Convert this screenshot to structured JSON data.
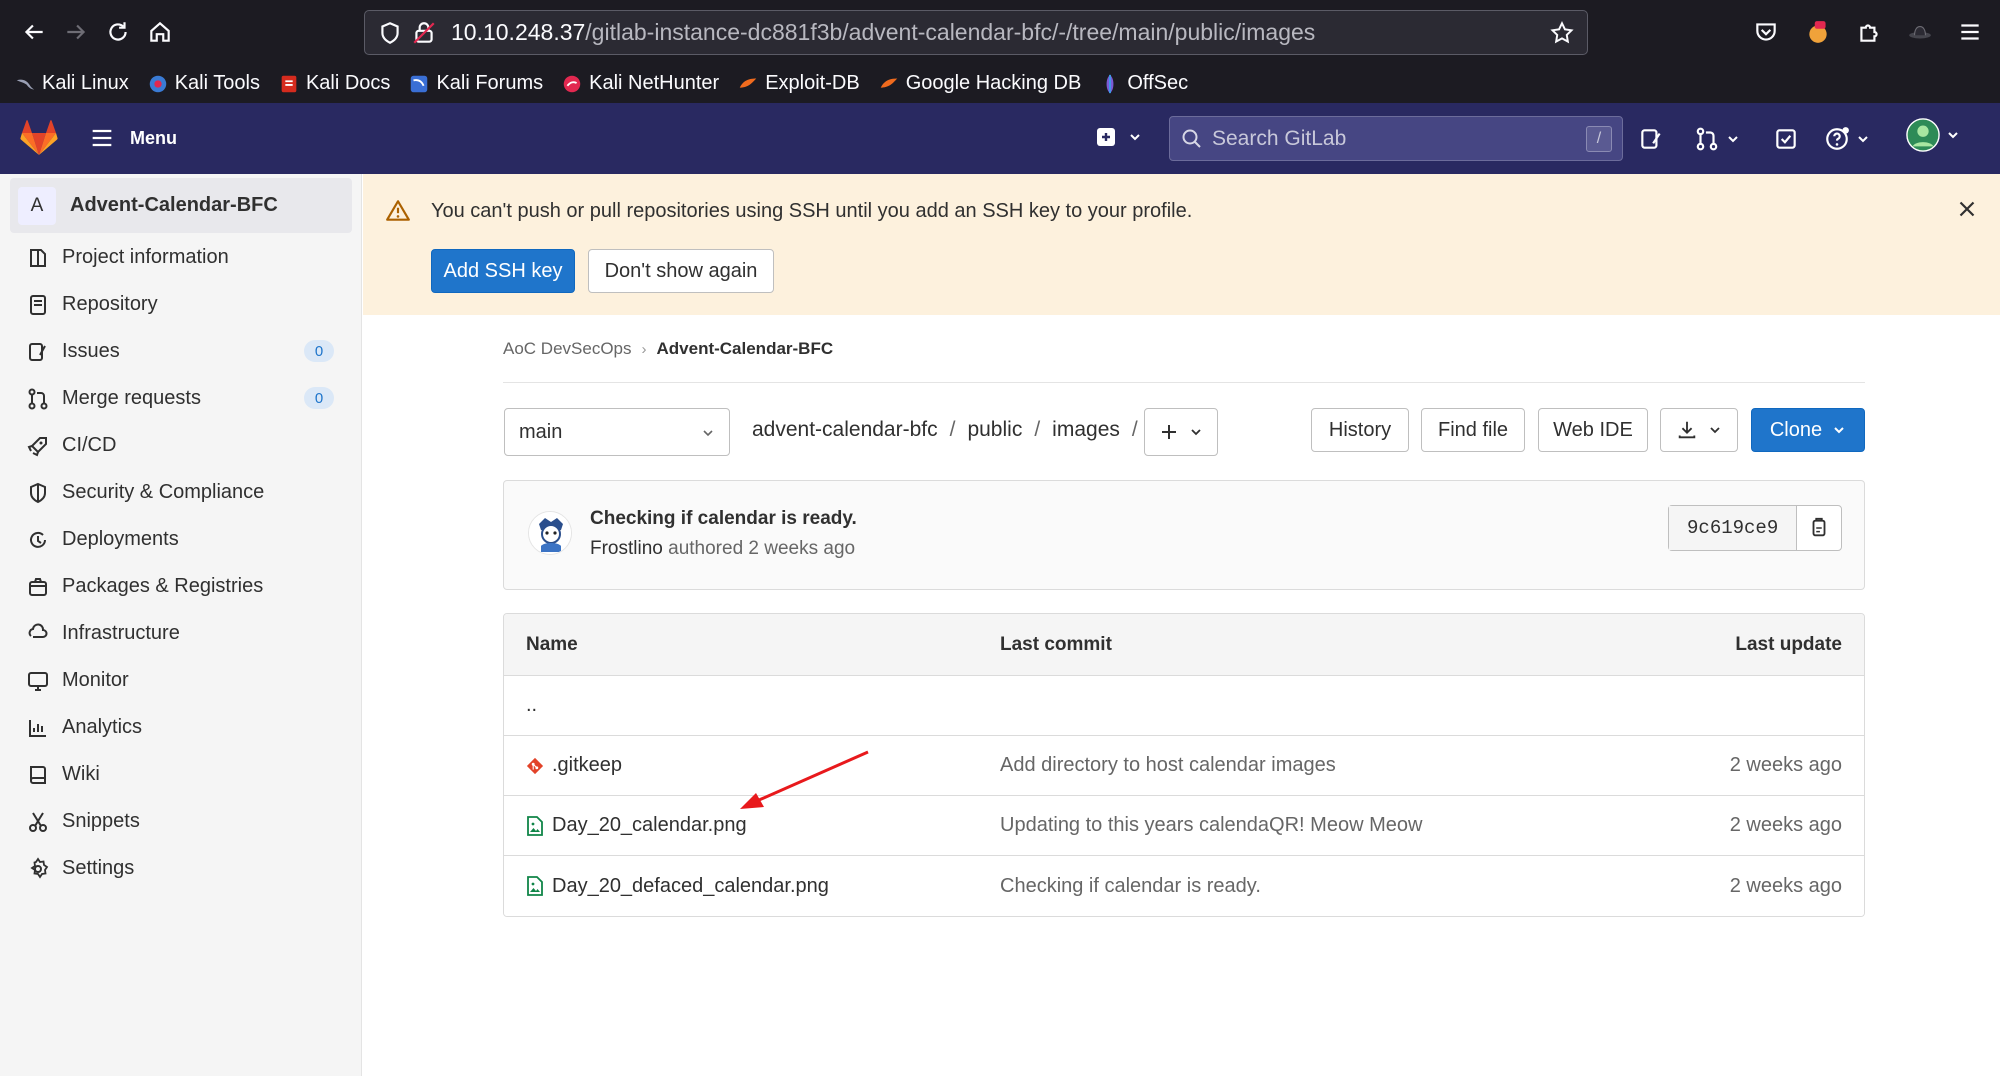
{
  "browser": {
    "url_host": "10.10.248.37",
    "url_path": "/gitlab-instance-dc881f3b/advent-calendar-bfc/-/tree/main/public/images",
    "bookmarks": [
      {
        "label": "Kali Linux",
        "icon": "kali-dragon-icon"
      },
      {
        "label": "Kali Tools",
        "icon": "kali-tools-icon"
      },
      {
        "label": "Kali Docs",
        "icon": "kali-docs-icon"
      },
      {
        "label": "Kali Forums",
        "icon": "kali-forums-icon"
      },
      {
        "label": "Kali NetHunter",
        "icon": "nethunter-icon"
      },
      {
        "label": "Exploit-DB",
        "icon": "exploit-db-icon"
      },
      {
        "label": "Google Hacking DB",
        "icon": "ghdb-icon"
      },
      {
        "label": "OffSec",
        "icon": "offsec-icon"
      }
    ]
  },
  "gitlab_header": {
    "menu_label": "Menu",
    "search_placeholder": "Search GitLab",
    "search_shortcut": "/"
  },
  "sidebar": {
    "project_initial": "A",
    "project_name": "Advent-Calendar-BFC",
    "items": [
      {
        "label": "Project information",
        "icon": "project-info-icon"
      },
      {
        "label": "Repository",
        "icon": "repository-icon"
      },
      {
        "label": "Issues",
        "icon": "issues-icon",
        "count": "0"
      },
      {
        "label": "Merge requests",
        "icon": "merge-request-icon",
        "count": "0"
      },
      {
        "label": "CI/CD",
        "icon": "rocket-icon"
      },
      {
        "label": "Security & Compliance",
        "icon": "shield-icon"
      },
      {
        "label": "Deployments",
        "icon": "deployments-icon"
      },
      {
        "label": "Packages & Registries",
        "icon": "package-icon"
      },
      {
        "label": "Infrastructure",
        "icon": "infrastructure-icon"
      },
      {
        "label": "Monitor",
        "icon": "monitor-icon"
      },
      {
        "label": "Analytics",
        "icon": "chart-icon"
      },
      {
        "label": "Wiki",
        "icon": "book-icon"
      },
      {
        "label": "Snippets",
        "icon": "snippet-icon"
      },
      {
        "label": "Settings",
        "icon": "gear-icon"
      }
    ]
  },
  "banner": {
    "message": "You can't push or pull repositories using SSH until you add an SSH key to your profile.",
    "primary_button": "Add SSH key",
    "secondary_button": "Don't show again"
  },
  "breadcrumb": {
    "group": "AoC DevSecOps",
    "project": "Advent-Calendar-BFC"
  },
  "repo_toolbar": {
    "branch": "main",
    "path": [
      "advent-calendar-bfc",
      "public",
      "images"
    ],
    "history": "History",
    "find_file": "Find file",
    "web_ide": "Web IDE",
    "clone": "Clone"
  },
  "last_commit": {
    "title": "Checking if calendar is ready.",
    "author": "Frostlino",
    "authored_text": "authored 2 weeks ago",
    "sha": "9c619ce9"
  },
  "file_table": {
    "headers": {
      "name": "Name",
      "last_commit": "Last commit",
      "last_update": "Last update"
    },
    "parent": "..",
    "rows": [
      {
        "name": ".gitkeep",
        "commit": "Add directory to host calendar images",
        "updated": "2 weeks ago",
        "icon": "git-file-icon"
      },
      {
        "name": "Day_20_calendar.png",
        "commit": "Updating to this years calendaQR! Meow Meow",
        "updated": "2 weeks ago",
        "icon": "image-file-icon"
      },
      {
        "name": "Day_20_defaced_calendar.png",
        "commit": "Checking if calendar is ready.",
        "updated": "2 weeks ago",
        "icon": "image-file-icon"
      }
    ]
  },
  "colors": {
    "header_bg": "#292961",
    "primary": "#1f75cb",
    "banner_bg": "#fdf1dd",
    "annotation_arrow": "#e8191c"
  }
}
